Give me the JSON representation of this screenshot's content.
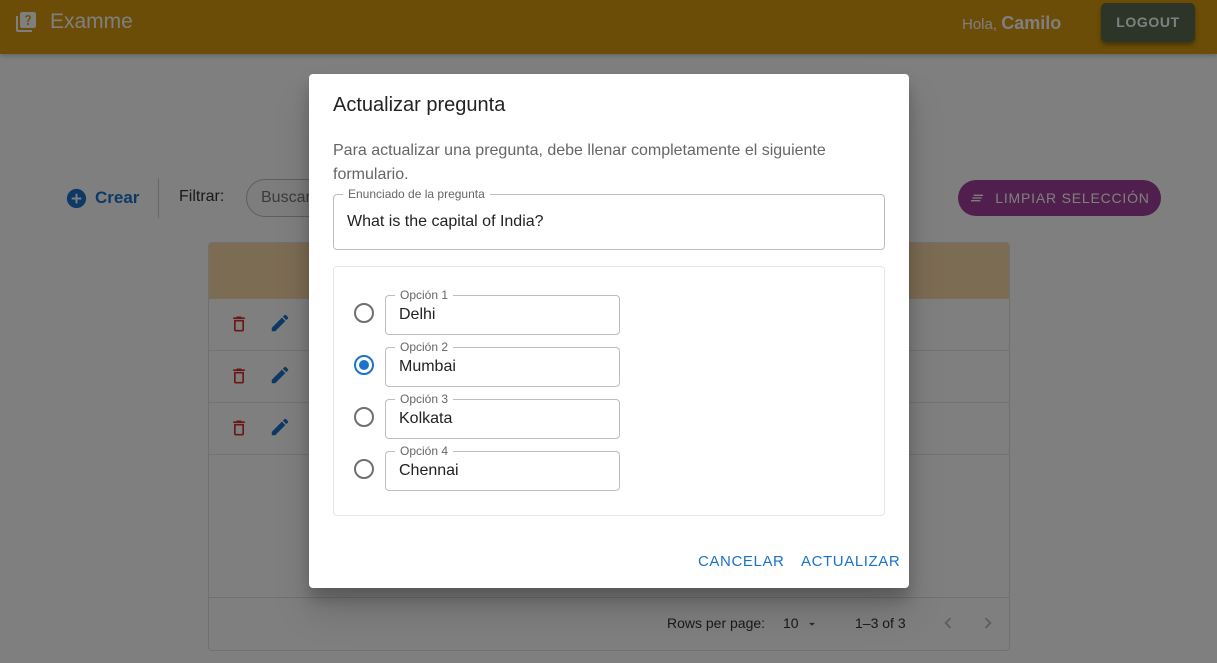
{
  "app": {
    "name": "Examme"
  },
  "header": {
    "greeting": "Hola,",
    "user": "Camilo",
    "logout_label": "LOGOUT"
  },
  "toolbar": {
    "create_label": "Crear",
    "filter_label": "Filtrar:",
    "search_placeholder": "Buscar",
    "clear_selection_label": "LIMPIAR SELECCIÓN"
  },
  "table": {
    "rows": 3,
    "footer": {
      "rows_per_page_label": "Rows per page:",
      "rows_per_page_value": "10",
      "range": "1–3 of 3"
    }
  },
  "dialog": {
    "title": "Actualizar pregunta",
    "description": "Para actualizar una pregunta, debe llenar completamente el siguiente formulario.",
    "question_label": "Enunciado de la pregunta",
    "question_value": "What is the capital of India?",
    "options": [
      {
        "label": "Opción 1",
        "value": "Delhi",
        "selected": false
      },
      {
        "label": "Opción 2",
        "value": "Mumbai",
        "selected": true
      },
      {
        "label": "Opción 3",
        "value": "Kolkata",
        "selected": false
      },
      {
        "label": "Opción 4",
        "value": "Chennai",
        "selected": false
      }
    ],
    "cancel_label": "CANCELAR",
    "update_label": "ACTUALIZAR"
  },
  "colors": {
    "appbar": "#d69b0e",
    "primary": "#1a73c8",
    "accent": "#a23e9c",
    "delete": "#d32f2f",
    "table_header": "#fbd9a9"
  }
}
